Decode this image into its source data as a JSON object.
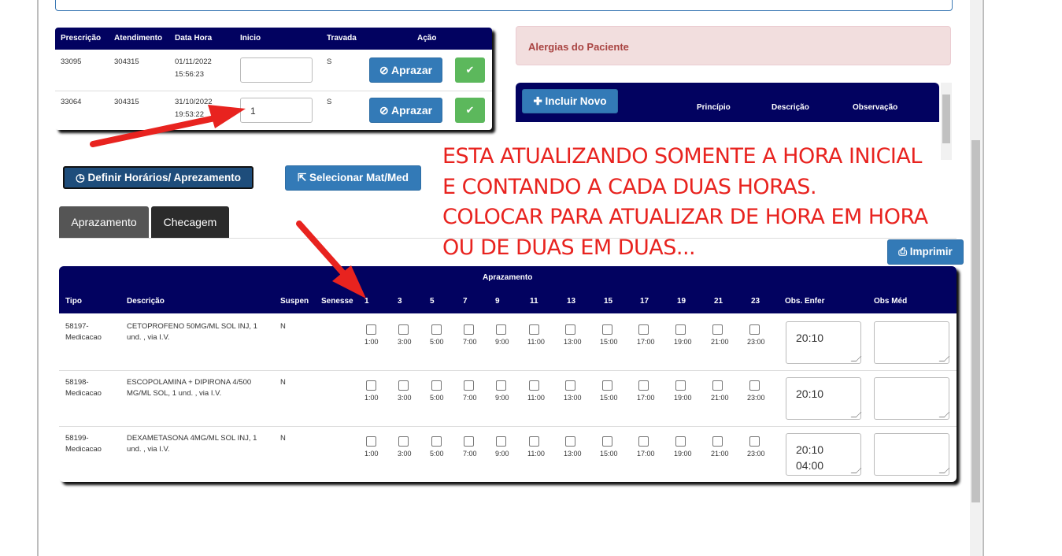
{
  "prescricao_table": {
    "headers": [
      "Prescrição",
      "Atendimento",
      "Data Hora",
      "Inicio",
      "Travada",
      "Ação"
    ],
    "rows": [
      {
        "prescricao": "33095",
        "atendimento": "304315",
        "data": "01/11/2022",
        "hora": "15:56:23",
        "inicio": "",
        "travada": "S",
        "acao": "Aprazar"
      },
      {
        "prescricao": "33064",
        "atendimento": "304315",
        "data": "31/10/2022",
        "hora": "19:53:22",
        "inicio": "1",
        "travada": "S",
        "acao": "Aprazar"
      }
    ],
    "check_icon": "check-circle-icon"
  },
  "alergias": {
    "title": "Alergias do Paciente"
  },
  "alergias_table": {
    "add_label": "Incluir Novo",
    "headers": [
      "Princípio",
      "Descrição",
      "Observação"
    ]
  },
  "annotation": {
    "text": "ESTA ATUALIZANDO SOMENTE A HORA INICIAL\nE CONTANDO A CADA DUAS HORAS.\nCOLOCAR PARA ATUALIZAR DE HORA EM HORA\nOU DE DUAS EM DUAS...",
    "color": "#e8231f"
  },
  "buttons": {
    "definir": "Definir Horários/ Aprezamento",
    "selecionar": "Selecionar Mat/Med",
    "imprimir": "Imprimir"
  },
  "tabs": [
    {
      "label": "Aprazamento",
      "active": true
    },
    {
      "label": "Checagem",
      "active": false
    }
  ],
  "aprazamento_table": {
    "title": "Aprazamento",
    "headers": {
      "tipo": "Tipo",
      "descricao": "Descrição",
      "suspen": "Suspen",
      "senesse": "Senesse",
      "obs_enfer": "Obs. Enfer",
      "obs_med": "Obs Méd"
    },
    "hours": [
      "1",
      "3",
      "5",
      "7",
      "9",
      "11",
      "13",
      "15",
      "17",
      "19",
      "21",
      "23"
    ],
    "checkbox_labels": [
      "1:00",
      "3:00",
      "5:00",
      "7:00",
      "9:00",
      "11:00",
      "13:00",
      "15:00",
      "17:00",
      "19:00",
      "21:00",
      "23:00"
    ],
    "rows": [
      {
        "tipo": "58197-\nMedicacao",
        "descricao": "CETOPROFENO 50MG/ML SOL INJ, 1 und. , via I.V.",
        "suspen": "N",
        "obs_enfer": "20:10",
        "obs_med": ""
      },
      {
        "tipo": "58198-\nMedicacao",
        "descricao": "ESCOPOLAMINA + DIPIRONA 4/500 MG/ML SOL, 1 und. , via I.V.",
        "suspen": "N",
        "obs_enfer": "20:10",
        "obs_med": ""
      },
      {
        "tipo": "58199-\nMedicacao",
        "descricao": "DEXAMETASONA 4MG/ML SOL INJ, 1 und. , via I.V.",
        "suspen": "N",
        "obs_enfer": "20:10\n04:00",
        "obs_med": ""
      }
    ]
  },
  "colors": {
    "navy": "#020260",
    "primary": "#337ab7",
    "success": "#5cb85c",
    "alert_bg": "#f2dede",
    "alert_text": "#a94442"
  }
}
